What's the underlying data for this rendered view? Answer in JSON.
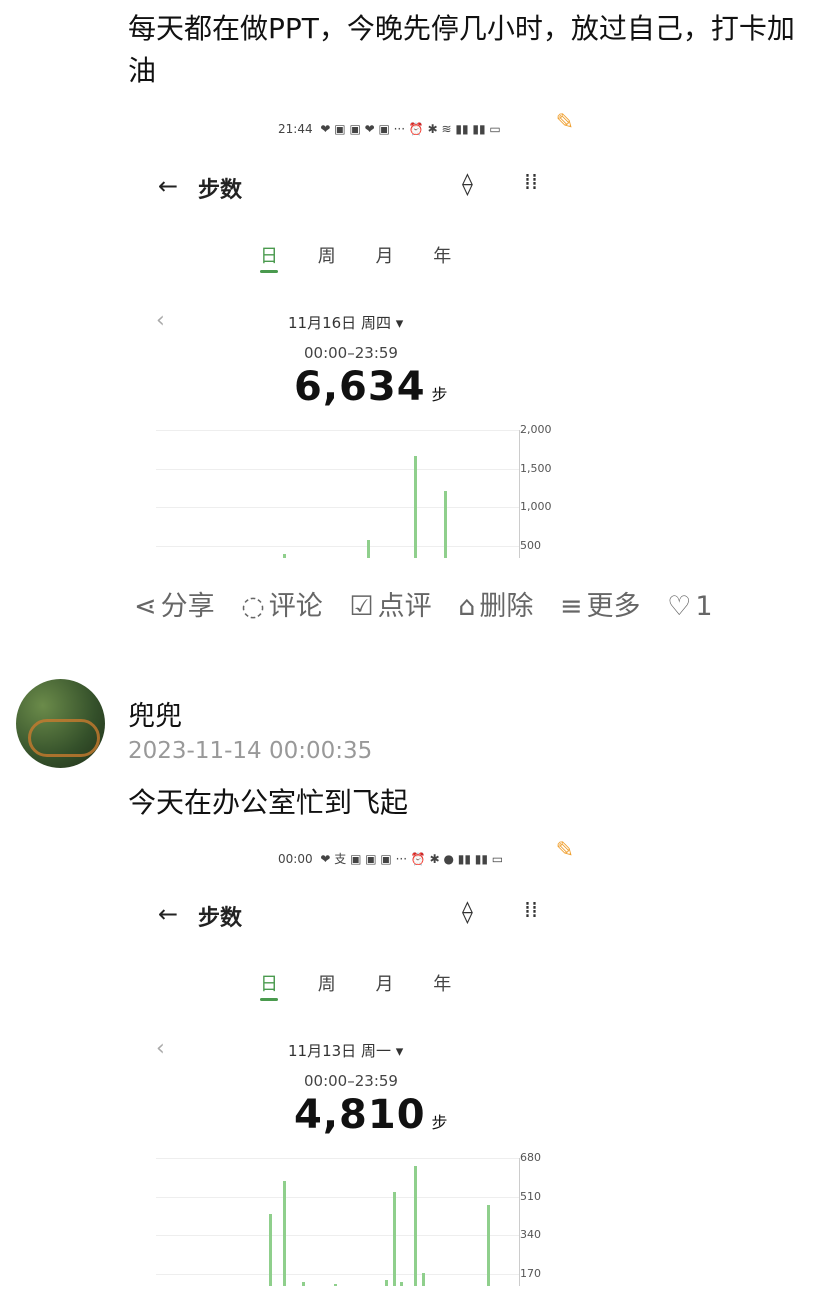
{
  "post1": {
    "text": "每天都在做PPT，今晚先停几小时，放过自己，打卡加油",
    "shot": {
      "time": "21:44",
      "status_icons": "❤ ▣ ▣ ❤ ▣ ··· ⏰ ✱ ≋ ▮▮ ▮▮ ▭",
      "title": "步数",
      "tabs": [
        "日",
        "周",
        "月",
        "年"
      ],
      "date": "11月16日 周四 ▾",
      "range": "00:00–23:59",
      "steps": "6,634",
      "unit": "步",
      "chart_data": {
        "type": "bar",
        "y_ticks": [
          "2,000",
          "1,500",
          "1,000",
          "500"
        ],
        "ylim": [
          0,
          2000
        ],
        "bars": [
          {
            "x": 0.35,
            "value": 60
          },
          {
            "x": 0.58,
            "value": 280
          },
          {
            "x": 0.71,
            "value": 1600
          },
          {
            "x": 0.79,
            "value": 1050
          }
        ]
      }
    }
  },
  "actions": {
    "share": "分享",
    "comment": "评论",
    "review": "点评",
    "delete": "删除",
    "more": "更多",
    "likes": "1"
  },
  "post2": {
    "user": "兜兜",
    "timestamp": "2023-11-14 00:00:35",
    "text": "今天在办公室忙到飞起",
    "shot": {
      "time": "00:00",
      "status_icons": "❤ 支 ▣ ▣ ▣ ··· ⏰ ✱ ● ▮▮ ▮▮ ▭",
      "title": "步数",
      "tabs": [
        "日",
        "周",
        "月",
        "年"
      ],
      "date": "11月13日 周一 ▾",
      "range": "00:00–23:59",
      "steps": "4,810",
      "unit": "步",
      "chart_data": {
        "type": "bar",
        "y_ticks": [
          "680",
          "510",
          "340",
          "170"
        ],
        "ylim": [
          0,
          680
        ],
        "bars": [
          {
            "x": 0.31,
            "value": 380
          },
          {
            "x": 0.35,
            "value": 560
          },
          {
            "x": 0.4,
            "value": 20
          },
          {
            "x": 0.49,
            "value": 5
          },
          {
            "x": 0.63,
            "value": 30
          },
          {
            "x": 0.65,
            "value": 500
          },
          {
            "x": 0.67,
            "value": 20
          },
          {
            "x": 0.71,
            "value": 640
          },
          {
            "x": 0.73,
            "value": 70
          },
          {
            "x": 0.91,
            "value": 430
          }
        ]
      }
    }
  }
}
